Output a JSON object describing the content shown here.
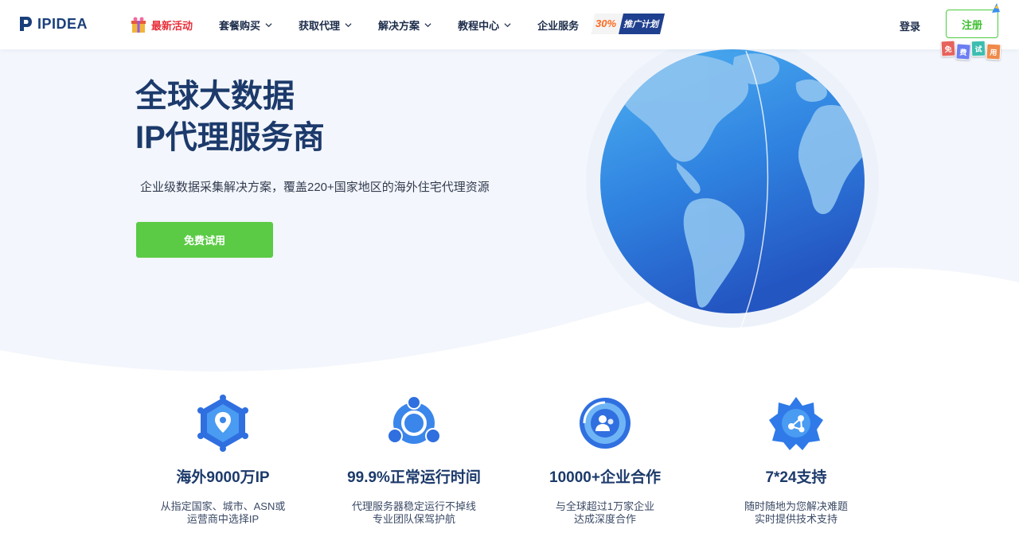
{
  "brand": {
    "name": "IPIDEA"
  },
  "nav": {
    "items": [
      {
        "label": "最新活动",
        "has_dropdown": false,
        "highlight": true
      },
      {
        "label": "套餐购买",
        "has_dropdown": true
      },
      {
        "label": "获取代理",
        "has_dropdown": true
      },
      {
        "label": "解决方案",
        "has_dropdown": true
      },
      {
        "label": "教程中心",
        "has_dropdown": true
      },
      {
        "label": "企业服务",
        "has_dropdown": false
      }
    ],
    "promo": {
      "badge": "30%",
      "label": "推广计划"
    },
    "login_label": "登录",
    "register_label": "注册",
    "free_tags": [
      "免",
      "费",
      "试",
      "用"
    ]
  },
  "hero": {
    "title_line1": "全球大数据",
    "title_line2": "IP代理服务商",
    "subtitle": "企业级数据采集解决方案，覆盖220+国家地区的海外住宅代理资源",
    "cta_label": "免费试用"
  },
  "features": [
    {
      "icon": "location-hex-icon",
      "title": "海外9000万IP",
      "desc": "从指定国家、城市、ASN或\n运营商中选择IP"
    },
    {
      "icon": "network-nodes-icon",
      "title": "99.9%正常运行时间",
      "desc": "代理服务器稳定运行不掉线\n专业团队保驾护航"
    },
    {
      "icon": "enterprise-users-icon",
      "title": "10000+企业合作",
      "desc": "与全球超过1万家企业\n达成深度合作"
    },
    {
      "icon": "support-gear-icon",
      "title": "7*24支持",
      "desc": "随时随地为您解决难题\n实时提供技术支持"
    }
  ],
  "colors": {
    "brand_navy": "#1c3a6b",
    "accent_green": "#5bcb45",
    "hot_red": "#e8303a",
    "globe_blue": "#2f7fe0"
  }
}
